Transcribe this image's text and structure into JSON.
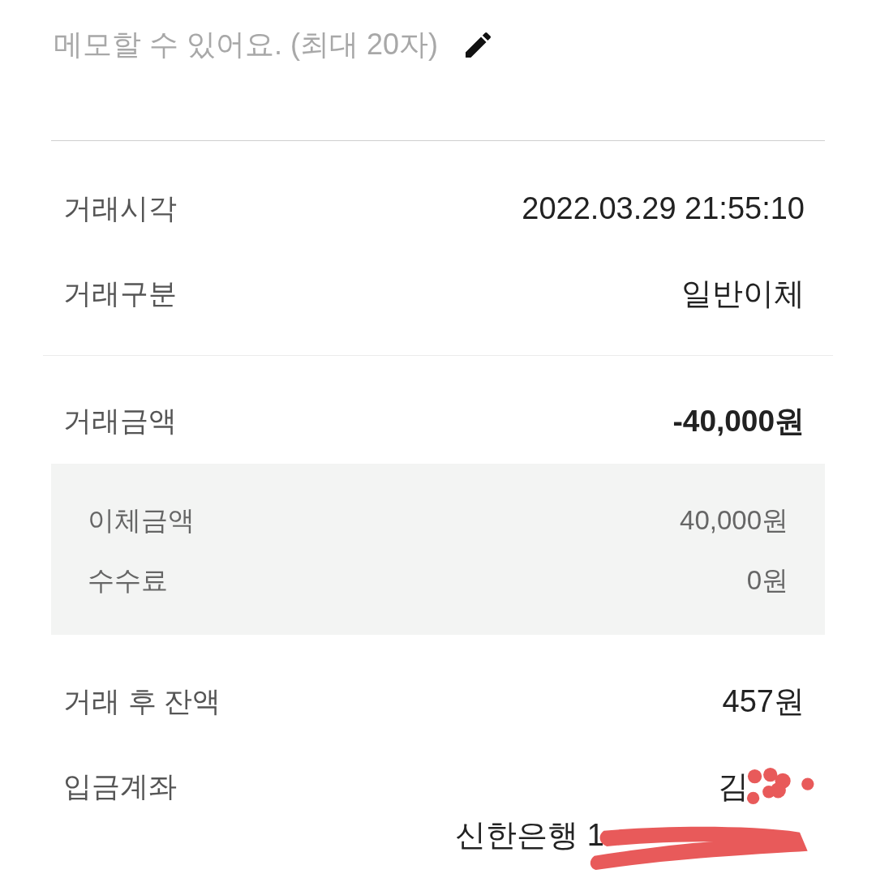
{
  "memo": {
    "placeholder": "메모할 수 있어요. (최대 20자)"
  },
  "details": [
    {
      "label": "거래시각",
      "value": "2022.03.29 21:55:10"
    },
    {
      "label": "거래구분",
      "value": "일반이체"
    }
  ],
  "amount": {
    "label": "거래금액",
    "value": "-40,000원",
    "breakdown": [
      {
        "label": "이체금액",
        "value": "40,000원"
      },
      {
        "label": "수수료",
        "value": "0원"
      }
    ]
  },
  "balance": {
    "label": "거래 후 잔액",
    "value": "457원"
  },
  "deposit_account": {
    "label": "입금계좌",
    "holder": "김",
    "account": "신한은행 1",
    "redacted": true
  }
}
